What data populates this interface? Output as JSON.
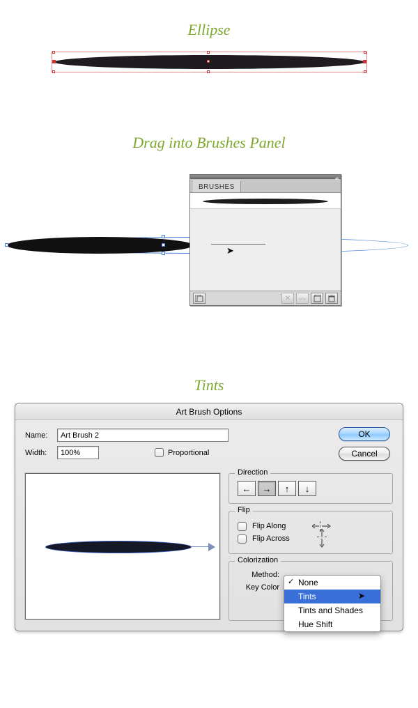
{
  "section1": {
    "heading": "Ellipse"
  },
  "section2": {
    "heading": "Drag into Brushes Panel",
    "panel": {
      "tab": "BRUSHES",
      "footer_icons": {
        "library": "library-icon",
        "break": "remove-stroke-icon",
        "options": "stroke-options-icon",
        "new": "new-brush-icon",
        "delete": "trash-icon"
      }
    }
  },
  "section3": {
    "heading": "Tints",
    "dialog": {
      "title": "Art Brush Options",
      "name_label": "Name:",
      "name_value": "Art Brush 2",
      "width_label": "Width:",
      "width_value": "100%",
      "proportional_label": "Proportional",
      "ok_label": "OK",
      "cancel_label": "Cancel",
      "direction_legend": "Direction",
      "flip_legend": "Flip",
      "flip_along_label": "Flip Along",
      "flip_across_label": "Flip Across",
      "colorization_legend": "Colorization",
      "method_label": "Method:",
      "keycolor_label": "Key Color",
      "method_options": {
        "none": "None",
        "tints": "Tints",
        "tints_shades": "Tints and Shades",
        "hue_shift": "Hue Shift"
      }
    }
  }
}
